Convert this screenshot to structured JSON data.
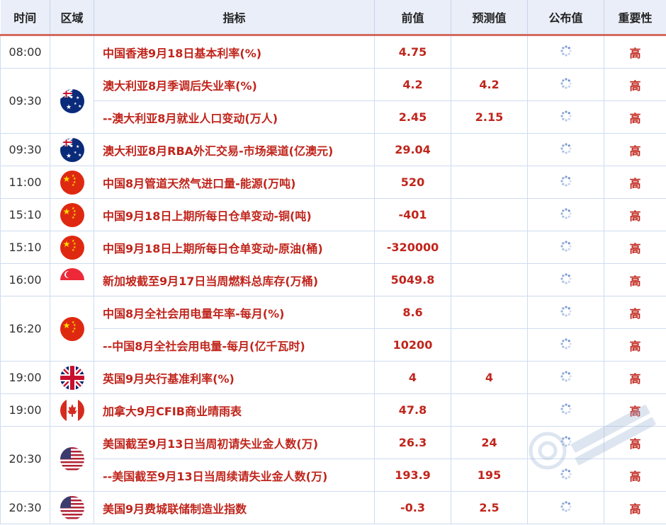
{
  "headers": {
    "time": "时间",
    "region": "区域",
    "indicator": "指标",
    "previous": "前值",
    "forecast": "预测值",
    "actual": "公布值",
    "importance": "重要性"
  },
  "rows": [
    {
      "time": "08:00",
      "flag": "none",
      "indicator": "中国香港9月18日基本利率(%)",
      "previous": "4.75",
      "forecast": "",
      "importance": "高"
    },
    {
      "time": "09:30",
      "flag": "australia-flag",
      "indicator": "澳大利亚8月季调后失业率(%)",
      "previous": "4.2",
      "forecast": "4.2",
      "importance": "高"
    },
    {
      "indicator": "--澳大利亚8月就业人口变动(万人)",
      "previous": "2.45",
      "forecast": "2.15",
      "importance": "高"
    },
    {
      "time": "09:30",
      "flag": "australia-flag",
      "indicator": "澳大利亚8月RBA外汇交易-市场渠道(亿澳元)",
      "previous": "29.04",
      "forecast": "",
      "importance": "高"
    },
    {
      "time": "11:00",
      "flag": "china-flag",
      "indicator": "中国8月管道天然气进口量-能源(万吨)",
      "previous": "520",
      "forecast": "",
      "importance": "高"
    },
    {
      "time": "15:10",
      "flag": "china-flag",
      "indicator": "中国9月18日上期所每日仓单变动-铜(吨)",
      "previous": "-401",
      "forecast": "",
      "importance": "高"
    },
    {
      "time": "15:10",
      "flag": "china-flag",
      "indicator": "中国9月18日上期所每日仓单变动-原油(桶)",
      "previous": "-320000",
      "forecast": "",
      "importance": "高"
    },
    {
      "time": "16:00",
      "flag": "singapore-flag",
      "indicator": "新加坡截至9月17日当周燃料总库存(万桶)",
      "previous": "5049.8",
      "forecast": "",
      "importance": "高"
    },
    {
      "time": "16:20",
      "flag": "china-flag",
      "indicator": "中国8月全社会用电量年率-每月(%)",
      "previous": "8.6",
      "forecast": "",
      "importance": "高"
    },
    {
      "indicator": "--中国8月全社会用电量-每月(亿千瓦时)",
      "previous": "10200",
      "forecast": "",
      "importance": "高"
    },
    {
      "time": "19:00",
      "flag": "uk-flag",
      "indicator": "英国9月央行基准利率(%)",
      "previous": "4",
      "forecast": "4",
      "importance": "高"
    },
    {
      "time": "19:00",
      "flag": "canada-flag",
      "indicator": "加拿大9月CFIB商业晴雨表",
      "previous": "47.8",
      "forecast": "",
      "importance": "高"
    },
    {
      "time": "20:30",
      "flag": "us-flag",
      "indicator": "美国截至9月13日当周初请失业金人数(万)",
      "previous": "26.3",
      "forecast": "24",
      "importance": "高"
    },
    {
      "indicator": "--美国截至9月13日当周续请失业金人数(万)",
      "previous": "193.9",
      "forecast": "195",
      "importance": "高"
    },
    {
      "time": "20:30",
      "flag": "us-flag",
      "indicator": "美国9月费城联储制造业指数",
      "previous": "-0.3",
      "forecast": "2.5",
      "importance": "高"
    }
  ],
  "watermark": {
    "logo": "fx678-logo-watermark"
  },
  "colors": {
    "accent_red": "#c0251c",
    "header_bg": "#e9eef8",
    "header_rule": "#d46a5f",
    "grid": "#cfdcf0"
  }
}
